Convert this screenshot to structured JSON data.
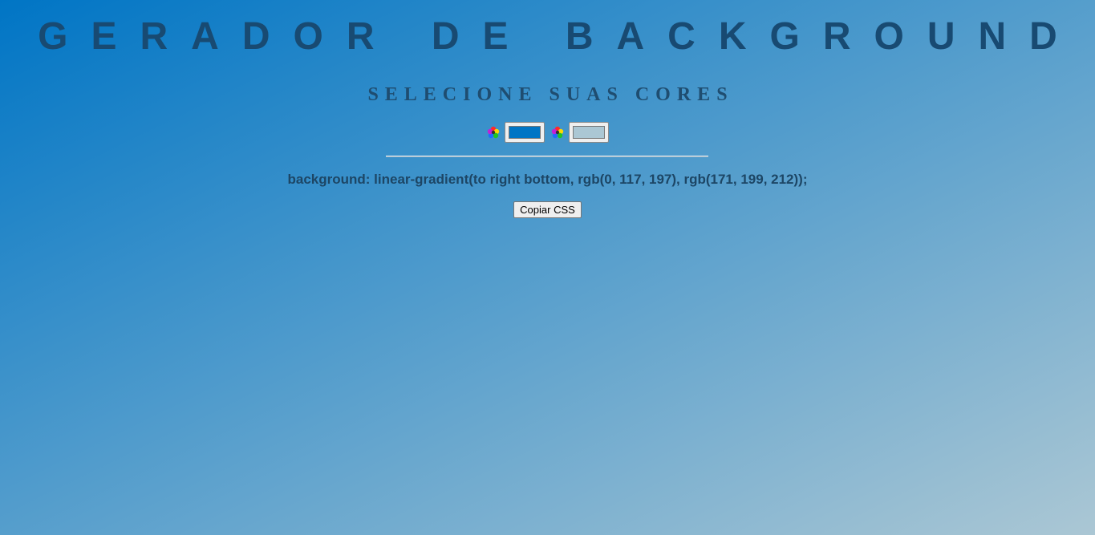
{
  "header": {
    "title": "GERADOR DE BACKGROUND",
    "subtitle": "SELECIONE SUAS CORES"
  },
  "pickers": [
    {
      "value": "#0075c5",
      "icon": "color-wheel-icon"
    },
    {
      "value": "#abc7d4",
      "icon": "color-wheel-icon"
    }
  ],
  "output": {
    "css_text": "background: linear-gradient(to right bottom, rgb(0, 117, 197), rgb(171, 199, 212));"
  },
  "actions": {
    "copy_label": "Copiar CSS"
  }
}
